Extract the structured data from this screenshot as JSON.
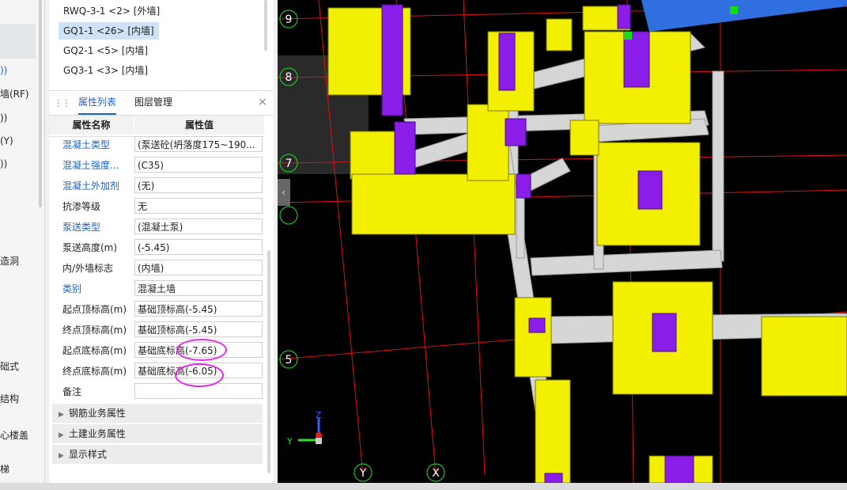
{
  "left_nav": {
    "items": [
      {
        "text": "))",
        "blue": true
      },
      {
        "text": "墙(RF)",
        "blue": false
      },
      {
        "text": "))",
        "blue": false
      },
      {
        "text": "(Y)",
        "blue": false
      },
      {
        "text": "))",
        "blue": false
      },
      {
        "text": "造洞",
        "blue": false
      },
      {
        "text": "础式",
        "blue": false
      },
      {
        "text": "结构",
        "blue": false
      },
      {
        "text": "心楼盖",
        "blue": false
      },
      {
        "text": "梯",
        "blue": false
      }
    ]
  },
  "component_list": [
    {
      "label": "RWQ-3-1 <2> [外墙]",
      "selected": false
    },
    {
      "label": "GQ1-1 <26> [内墙]",
      "selected": true
    },
    {
      "label": "GQ2-1 <5> [内墙]",
      "selected": false
    },
    {
      "label": "GQ3-1 <3> [内墙]",
      "selected": false
    }
  ],
  "tabs": {
    "properties": "属性列表",
    "layers": "图层管理",
    "close": "×"
  },
  "property_table": {
    "header": {
      "name": "属性名称",
      "value": "属性值"
    },
    "rows": [
      {
        "name": "混凝土类型",
        "value": "(泵送砼(坍落度175~190...",
        "blue": true
      },
      {
        "name": "混凝土强度...",
        "value": "(C35)",
        "blue": true
      },
      {
        "name": "混凝土外加剂",
        "value": "(无)",
        "blue": true
      },
      {
        "name": "抗渗等级",
        "value": "无",
        "blue": false
      },
      {
        "name": "泵送类型",
        "value": "(混凝土泵)",
        "blue": true
      },
      {
        "name": "泵送高度(m)",
        "value": "(-5.45)",
        "blue": false
      },
      {
        "name": "内/外墙标志",
        "value": "(内墙)",
        "blue": false
      },
      {
        "name": "类别",
        "value": "混凝土墙",
        "blue": true
      },
      {
        "name": "起点顶标高(m)",
        "value": "基础顶标高(-5.45)",
        "blue": false
      },
      {
        "name": "终点顶标高(m)",
        "value": "基础顶标高(-5.45)",
        "blue": false
      },
      {
        "name": "起点底标高(m)",
        "value": "基础底标高(-7.65)",
        "blue": false
      },
      {
        "name": "终点底标高(m)",
        "value": "基础底标高(-6.05)",
        "blue": false
      },
      {
        "name": "备注",
        "value": "",
        "blue": false
      }
    ],
    "sections": [
      "钢筋业务属性",
      "土建业务属性",
      "显示样式"
    ]
  },
  "viewport": {
    "grid_labels": {
      "r9": "9",
      "r8": "8",
      "r7": "7",
      "r5": "5",
      "cY": "Y",
      "cX": "X"
    },
    "axis": {
      "z": "Z",
      "y": "Y"
    },
    "colors": {
      "wall": "#f2f000",
      "column": "#8a1ee8",
      "beam": "#d8d8d8",
      "grid_line": "#e01010",
      "background": "#000000",
      "highlight": "#e229e8"
    }
  }
}
